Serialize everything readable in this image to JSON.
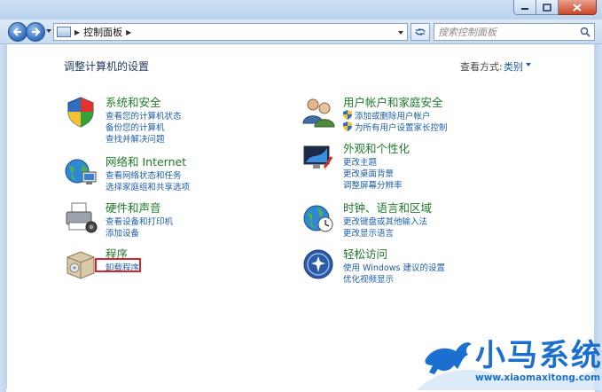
{
  "window": {
    "address": "控制面板",
    "search_placeholder": "搜索控制面板"
  },
  "page": {
    "title": "调整计算机的设置",
    "view_by_label": "查看方式:",
    "view_by_value": "类别"
  },
  "categories": {
    "system": {
      "title": "系统和安全",
      "links": [
        "查看您的计算机状态",
        "备份您的计算机",
        "查找并解决问题"
      ]
    },
    "network": {
      "title": "网络和 Internet",
      "links": [
        "查看网络状态和任务",
        "选择家庭组和共享选项"
      ]
    },
    "hardware": {
      "title": "硬件和声音",
      "links": [
        "查看设备和打印机",
        "添加设备"
      ]
    },
    "programs": {
      "title": "程序",
      "links": [
        "卸载程序"
      ]
    },
    "users": {
      "title": "用户帐户和家庭安全",
      "links": [
        "添加或删除用户帐户",
        "为所有用户设置家长控制"
      ]
    },
    "appearance": {
      "title": "外观和个性化",
      "links": [
        "更改主题",
        "更改桌面背景",
        "调整屏幕分辨率"
      ]
    },
    "clock": {
      "title": "时钟、语言和区域",
      "links": [
        "更改键盘或其他输入法",
        "更改显示语言"
      ]
    },
    "ease": {
      "title": "轻松访问",
      "links": [
        "使用 Windows 建议的设置",
        "优化视频显示"
      ]
    }
  },
  "watermark": {
    "title": "小马系统",
    "url": "www.xiaomaxitong.com"
  },
  "colors": {
    "category_title": "#1f7a2a",
    "link": "#1c5ea8",
    "highlight": "#d6262b",
    "watermark": "#1a6fd0"
  }
}
